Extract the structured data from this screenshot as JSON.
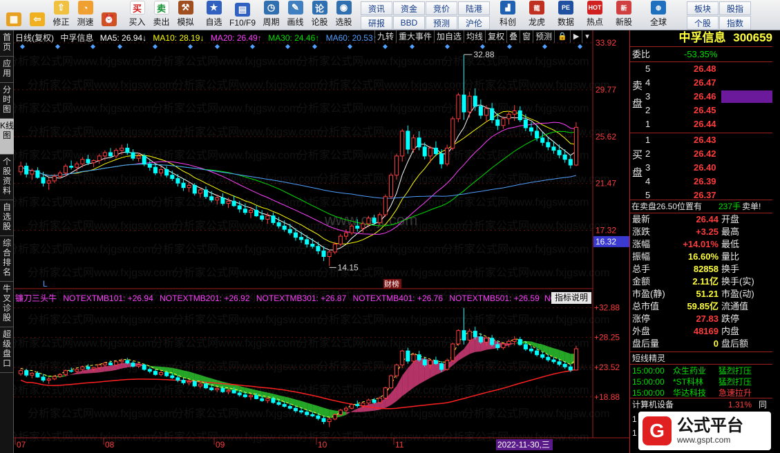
{
  "toolbar": {
    "buttons": [
      {
        "id": "home",
        "label": "",
        "icon": "windows-icon"
      },
      {
        "id": "back",
        "label": "",
        "icon": "back-arrow-icon"
      },
      {
        "id": "modify",
        "label": "修正",
        "icon": "up-arrow-icon"
      },
      {
        "id": "test",
        "label": "测速",
        "icon": "clock-icon"
      },
      {
        "id": "alarm",
        "label": "",
        "icon": "alarm-clock-icon"
      },
      {
        "id": "buy",
        "label": "买入",
        "icon": "buy-icon"
      },
      {
        "id": "sell",
        "label": "卖出",
        "icon": "sell-icon"
      },
      {
        "id": "sim",
        "label": "模拟",
        "icon": "gavel-icon"
      },
      {
        "id": "watch",
        "label": "自选",
        "icon": "star-icon"
      },
      {
        "id": "f10",
        "label": "F10/F9",
        "icon": "f10-icon"
      },
      {
        "id": "cycle",
        "label": "周期",
        "icon": "cycle-icon"
      },
      {
        "id": "draw",
        "label": "画线",
        "icon": "pencil-icon"
      },
      {
        "id": "stock",
        "label": "论股",
        "icon": "chat-icon"
      },
      {
        "id": "select",
        "label": "选股",
        "icon": "select-icon"
      }
    ],
    "grid_labels": [
      "资讯",
      "资金",
      "竞价",
      "陆港",
      "研报",
      "BBD",
      "预测",
      "沪伦"
    ],
    "tail_buttons": [
      {
        "label": "科创",
        "icon": "chart-icon"
      },
      {
        "label": "龙虎",
        "icon": "dragon-icon"
      },
      {
        "label": "数据",
        "icon": "pe-icon"
      },
      {
        "label": "热点",
        "icon": "hot-icon"
      },
      {
        "label": "新股",
        "icon": "new-icon"
      },
      {
        "label": "全球",
        "icon": "globe-icon"
      }
    ],
    "right_grid": [
      "板块",
      "股指",
      "个股",
      "指数"
    ]
  },
  "left_tabs": [
    "首页",
    "应用",
    "分时图",
    "K线图",
    "个股资料",
    "自选股",
    "综合排名",
    "牛叉诊股",
    "超级盘口"
  ],
  "active_tab": "K线图",
  "main_legend": {
    "period": "日线(复权)",
    "name": "中孚信息",
    "ma5": "MA5: 26.94↓",
    "ma10": "MA10: 28.19↓",
    "ma20": "MA20: 26.49↑",
    "ma30": "MA30: 24.46↑",
    "ma60": "MA60: 20.53↑"
  },
  "chart_buttons": [
    "九转",
    "重大事件",
    "加自选",
    "均线",
    "复权",
    "叠",
    "窗",
    "预测"
  ],
  "indicator_legend": {
    "name": "镰刀三头牛",
    "m1": "NOTEXTMB101: +26.94",
    "m2": "NOTEXTMB201: +26.92",
    "m3": "NOTEXTMB301: +26.87",
    "m4": "NOTEXTMB401: +26.76",
    "m5": "NOTEXTMB501: +26.59",
    "m6": "NC",
    "help": "指标说明"
  },
  "chart_data": {
    "type": "candlestick",
    "main_axis": [
      "33.92",
      "29.77",
      "25.62",
      "21.47",
      "17.32"
    ],
    "main_axis_highlight": "16.32",
    "sub_axis": [
      "+32.88",
      "+28.25",
      "+23.52",
      "+18.88"
    ],
    "annotations": {
      "high": "32.88",
      "low": "14.15",
      "earn": "财榜",
      "l_mark": "L"
    },
    "x_labels": [
      "07",
      "08",
      "09",
      "10",
      "11"
    ],
    "cursor_date": "2022-11-30,三",
    "watermark": "www.gsjt.com",
    "candles": [
      [
        22.5,
        23.4,
        22.2,
        23.0
      ],
      [
        23.0,
        23.3,
        22.0,
        22.3
      ],
      [
        22.3,
        22.8,
        21.8,
        22.6
      ],
      [
        22.6,
        22.9,
        21.9,
        22.0
      ],
      [
        22.0,
        22.5,
        21.2,
        21.5
      ],
      [
        21.5,
        22.0,
        20.9,
        21.7
      ],
      [
        21.7,
        22.3,
        21.5,
        22.1
      ],
      [
        22.1,
        22.6,
        21.9,
        22.4
      ],
      [
        22.4,
        23.2,
        22.1,
        23.0
      ],
      [
        23.0,
        23.5,
        22.7,
        22.9
      ],
      [
        22.9,
        23.4,
        22.5,
        23.2
      ],
      [
        23.2,
        23.8,
        22.9,
        23.6
      ],
      [
        23.6,
        24.0,
        23.1,
        23.3
      ],
      [
        23.3,
        23.6,
        22.9,
        23.5
      ],
      [
        23.5,
        24.1,
        23.2,
        23.9
      ],
      [
        23.9,
        24.4,
        23.5,
        24.2
      ],
      [
        24.2,
        24.6,
        23.8,
        23.9
      ],
      [
        23.9,
        24.6,
        23.7,
        24.4
      ],
      [
        24.4,
        24.9,
        24.0,
        24.6
      ],
      [
        24.6,
        25.0,
        24.0,
        24.2
      ],
      [
        24.2,
        24.5,
        23.5,
        23.7
      ],
      [
        23.7,
        24.2,
        23.4,
        23.9
      ],
      [
        23.9,
        24.1,
        23.0,
        23.2
      ],
      [
        23.2,
        23.5,
        22.6,
        22.9
      ],
      [
        22.9,
        23.2,
        22.2,
        22.4
      ],
      [
        22.4,
        23.0,
        22.1,
        22.7
      ],
      [
        22.7,
        23.0,
        22.0,
        22.2
      ],
      [
        22.2,
        22.6,
        21.7,
        21.9
      ],
      [
        21.9,
        22.3,
        21.2,
        21.5
      ],
      [
        21.5,
        21.9,
        20.8,
        21.1
      ],
      [
        21.1,
        21.6,
        20.7,
        21.3
      ],
      [
        21.3,
        21.5,
        20.4,
        20.6
      ],
      [
        20.6,
        21.1,
        20.2,
        20.9
      ],
      [
        20.9,
        21.2,
        20.1,
        20.3
      ],
      [
        20.3,
        20.8,
        19.8,
        20.0
      ],
      [
        20.0,
        20.5,
        19.6,
        20.2
      ],
      [
        20.2,
        20.6,
        19.5,
        19.7
      ],
      [
        19.7,
        20.2,
        19.3,
        19.9
      ],
      [
        19.9,
        20.4,
        19.4,
        19.5
      ],
      [
        19.5,
        19.9,
        18.9,
        19.2
      ],
      [
        19.2,
        19.7,
        18.7,
        18.9
      ],
      [
        18.9,
        19.4,
        18.4,
        19.1
      ],
      [
        19.1,
        19.5,
        18.5,
        18.6
      ],
      [
        18.6,
        19.1,
        18.1,
        18.3
      ],
      [
        18.3,
        18.9,
        17.9,
        18.6
      ],
      [
        18.6,
        18.9,
        17.8,
        18.0
      ],
      [
        18.0,
        18.5,
        17.5,
        17.7
      ],
      [
        17.7,
        18.2,
        17.2,
        17.4
      ],
      [
        17.4,
        17.9,
        16.9,
        17.1
      ],
      [
        17.1,
        17.5,
        16.4,
        16.7
      ],
      [
        16.7,
        17.2,
        16.2,
        16.5
      ],
      [
        16.5,
        16.9,
        15.8,
        16.1
      ],
      [
        16.1,
        16.6,
        15.7,
        15.9
      ],
      [
        15.9,
        16.3,
        15.2,
        15.5
      ],
      [
        15.5,
        15.9,
        14.6,
        15.0
      ],
      [
        15.0,
        15.6,
        14.15,
        15.4
      ],
      [
        15.4,
        16.3,
        15.2,
        16.1
      ],
      [
        16.1,
        17.0,
        15.9,
        16.8
      ],
      [
        16.8,
        17.4,
        16.5,
        17.1
      ],
      [
        17.1,
        17.9,
        16.9,
        17.7
      ],
      [
        17.7,
        18.3,
        17.2,
        17.5
      ],
      [
        17.5,
        18.1,
        17.1,
        17.9
      ],
      [
        17.9,
        18.6,
        17.6,
        18.4
      ],
      [
        18.4,
        18.7,
        17.8,
        18.0
      ],
      [
        18.0,
        18.9,
        17.8,
        18.7
      ],
      [
        18.7,
        20.5,
        18.5,
        20.3
      ],
      [
        20.3,
        22.4,
        20.1,
        22.2
      ],
      [
        22.2,
        24.1,
        21.8,
        23.9
      ],
      [
        23.9,
        26.3,
        23.4,
        26.1
      ],
      [
        26.1,
        26.6,
        24.1,
        24.5
      ],
      [
        24.5,
        25.8,
        24.2,
        25.5
      ],
      [
        25.5,
        26.1,
        24.4,
        24.7
      ],
      [
        24.7,
        25.1,
        23.6,
        23.9
      ],
      [
        23.9,
        24.8,
        23.3,
        24.6
      ],
      [
        24.6,
        25.2,
        23.9,
        24.1
      ],
      [
        24.1,
        24.5,
        22.8,
        23.2
      ],
      [
        23.2,
        24.9,
        23.0,
        24.6
      ],
      [
        24.6,
        27.4,
        24.4,
        27.2
      ],
      [
        27.2,
        29.5,
        26.9,
        29.3
      ],
      [
        29.3,
        32.88,
        27.1,
        27.8
      ],
      [
        27.8,
        29.6,
        27.3,
        29.2
      ],
      [
        29.2,
        29.9,
        27.9,
        28.3
      ],
      [
        28.3,
        28.9,
        27.2,
        27.5
      ],
      [
        27.5,
        28.4,
        26.9,
        28.1
      ],
      [
        28.1,
        28.6,
        26.8,
        27.1
      ],
      [
        27.1,
        27.7,
        26.2,
        26.6
      ],
      [
        26.6,
        27.4,
        26.3,
        27.2
      ],
      [
        27.2,
        27.9,
        26.7,
        27.6
      ],
      [
        27.6,
        28.4,
        27.0,
        27.9
      ],
      [
        27.9,
        28.3,
        26.9,
        27.1
      ],
      [
        27.1,
        27.6,
        26.1,
        26.4
      ],
      [
        26.4,
        26.9,
        25.7,
        26.1
      ],
      [
        26.1,
        26.6,
        25.2,
        25.5
      ],
      [
        25.5,
        26.0,
        24.8,
        25.1
      ],
      [
        25.1,
        25.6,
        24.4,
        24.7
      ],
      [
        24.7,
        25.2,
        24.1,
        24.4
      ],
      [
        24.4,
        24.9,
        23.7,
        24.0
      ],
      [
        24.0,
        24.5,
        23.3,
        23.6
      ],
      [
        23.6,
        24.0,
        22.8,
        23.1
      ],
      [
        23.1,
        26.9,
        23.0,
        26.44
      ]
    ]
  },
  "quote": {
    "title": "中孚信息",
    "code": "300659",
    "weibi_label": "委比",
    "weibi": "-53.35%",
    "sell_label": [
      "卖",
      "盘"
    ],
    "buy_label": [
      "买",
      "盘"
    ],
    "asks": [
      [
        "5",
        "26.48"
      ],
      [
        "4",
        "26.47"
      ],
      [
        "3",
        "26.46"
      ],
      [
        "2",
        "26.45"
      ],
      [
        "1",
        "26.44"
      ]
    ],
    "bids": [
      [
        "1",
        "26.43"
      ],
      [
        "2",
        "26.42"
      ],
      [
        "3",
        "26.40"
      ],
      [
        "4",
        "26.39"
      ],
      [
        "5",
        "26.37"
      ]
    ],
    "alert": "在卖盘26.50位置有",
    "alert_vol": "237手",
    "alert_type": "卖单!",
    "stats": [
      [
        "最新",
        "26.44",
        "开盘",
        ""
      ],
      [
        "涨跌",
        "+3.25",
        "最高",
        ""
      ],
      [
        "涨幅",
        "+14.01%",
        "最低",
        ""
      ],
      [
        "振幅",
        "16.60%",
        "量比",
        ""
      ],
      [
        "总手",
        "82858",
        "换手",
        ""
      ],
      [
        "金额",
        "2.11亿",
        "换手(实)",
        ""
      ],
      [
        "市盈(静)",
        "51.21",
        "市盈(动)",
        ""
      ],
      [
        "总市值",
        "59.85亿",
        "流通值",
        ""
      ],
      [
        "涨停",
        "27.83",
        "跌停",
        ""
      ],
      [
        "外盘",
        "48169",
        "内盘",
        ""
      ],
      [
        "盘后量",
        "0",
        "盘后额",
        ""
      ]
    ],
    "sprite_title": "短线精灵",
    "sprites": [
      [
        "15:00:00",
        "众生药业",
        "猛烈打压"
      ],
      [
        "15:00:00",
        "*ST科林",
        "猛烈打压"
      ],
      [
        "15:00:00",
        "华达科技",
        "急速拉升"
      ]
    ],
    "sector": "计算机设备",
    "sector_pct": "1.31%",
    "sector_tail": "同行",
    "bottom_nums": [
      "1",
      "1"
    ],
    "logo_text": "公式平台",
    "logo_url": "www.gspt.com"
  },
  "colors": {
    "up": "#ff3c3c",
    "down": "#00ffff",
    "ma5": "#ffffff",
    "ma10": "#ffff00",
    "ma20": "#ff40ff",
    "ma30": "#00e000",
    "ma60": "#50a0ff"
  }
}
